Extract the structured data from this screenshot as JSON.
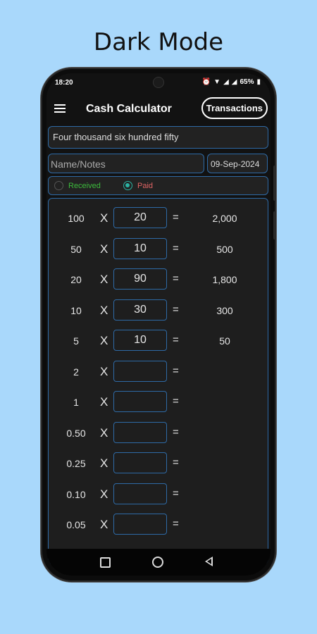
{
  "caption": "Dark Mode",
  "status": {
    "time": "18:20",
    "battery": "65%"
  },
  "appbar": {
    "title": "Cash Calculator",
    "transactions_label": "Transactions"
  },
  "form": {
    "amount_in_words": "Four thousand six hundred fifty",
    "name_placeholder": "Name/Notes",
    "date": "09-Sep-2024",
    "received_label": "Received",
    "paid_label": "Paid",
    "selected": "paid"
  },
  "rows": [
    {
      "denomination": "100",
      "qty": "20",
      "amount": "2,000"
    },
    {
      "denomination": "50",
      "qty": "10",
      "amount": "500"
    },
    {
      "denomination": "20",
      "qty": "90",
      "amount": "1,800"
    },
    {
      "denomination": "10",
      "qty": "30",
      "amount": "300"
    },
    {
      "denomination": "5",
      "qty": "10",
      "amount": "50"
    },
    {
      "denomination": "2",
      "qty": "",
      "amount": ""
    },
    {
      "denomination": "1",
      "qty": "",
      "amount": ""
    },
    {
      "denomination": "0.50",
      "qty": "",
      "amount": ""
    },
    {
      "denomination": "0.25",
      "qty": "",
      "amount": ""
    },
    {
      "denomination": "0.10",
      "qty": "",
      "amount": ""
    },
    {
      "denomination": "0.05",
      "qty": "",
      "amount": ""
    }
  ],
  "symbols": {
    "times": "X",
    "equals": "="
  },
  "colors": {
    "background": "#a9d8fb",
    "accent": "#2e6aa6",
    "received": "#3dbb3d",
    "paid": "#e06464"
  }
}
